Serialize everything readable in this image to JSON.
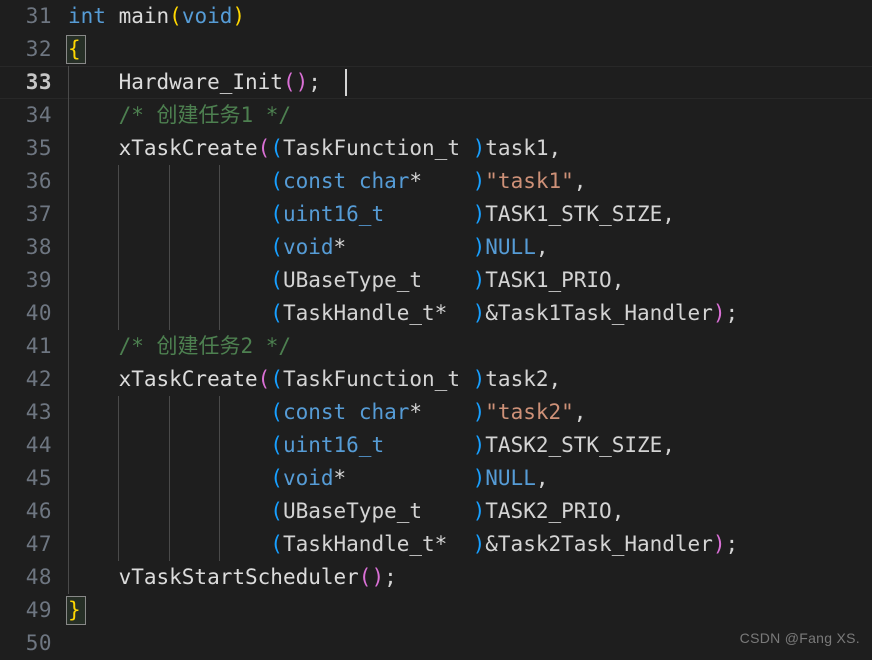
{
  "editor": {
    "language": "c",
    "theme": "dark-plus",
    "background_color": "#1e1e1e",
    "line_number_color": "#6e7681",
    "active_line_number_color": "#c6c6c6",
    "indent_guide_color": "#4a4a4a",
    "first_visible_line": 31,
    "last_visible_line": 50,
    "active_line": 33,
    "cursor_line": 33,
    "cursor_column": 23,
    "matching_brackets": [
      32,
      49
    ]
  },
  "colors": {
    "keyword": "#569cd6",
    "comment": "#4d8050",
    "string": "#ce9178",
    "identifier": "#d4d4d4",
    "bracket_yellow": "#ffd700",
    "bracket_magenta": "#da70d6",
    "bracket_blue": "#179fff"
  },
  "watermark": {
    "text": "CSDN @Fang XS."
  },
  "lines": [
    {
      "number": "31",
      "text": "int main(void)"
    },
    {
      "number": "32",
      "text": "{"
    },
    {
      "number": "33",
      "text": "    Hardware_Init();"
    },
    {
      "number": "34",
      "text": "    /* 创建任务1 */"
    },
    {
      "number": "35",
      "text": "    xTaskCreate((TaskFunction_t )task1,"
    },
    {
      "number": "36",
      "text": "                (const char*    )\"task1\","
    },
    {
      "number": "37",
      "text": "                (uint16_t       )TASK1_STK_SIZE,"
    },
    {
      "number": "38",
      "text": "                (void*          )NULL,"
    },
    {
      "number": "39",
      "text": "                (UBaseType_t    )TASK1_PRIO,"
    },
    {
      "number": "40",
      "text": "                (TaskHandle_t*  )&Task1Task_Handler);"
    },
    {
      "number": "41",
      "text": "    /* 创建任务2 */"
    },
    {
      "number": "42",
      "text": "    xTaskCreate((TaskFunction_t )task2,"
    },
    {
      "number": "43",
      "text": "                (const char*    )\"task2\","
    },
    {
      "number": "44",
      "text": "                (uint16_t       )TASK2_STK_SIZE,"
    },
    {
      "number": "45",
      "text": "                (void*          )NULL,"
    },
    {
      "number": "46",
      "text": "                (UBaseType_t    )TASK2_PRIO,"
    },
    {
      "number": "47",
      "text": "                (TaskHandle_t*  )&Task2Task_Handler);"
    },
    {
      "number": "48",
      "text": "    vTaskStartScheduler();"
    },
    {
      "number": "49",
      "text": "}"
    },
    {
      "number": "50",
      "text": ""
    }
  ],
  "tokens": {
    "l31": [
      {
        "t": "int",
        "c": "kw"
      },
      {
        "t": " ",
        "c": "punc"
      },
      {
        "t": "main",
        "c": "fn"
      },
      {
        "t": "(",
        "c": "p-yel"
      },
      {
        "t": "void",
        "c": "kw"
      },
      {
        "t": ")",
        "c": "p-yel"
      }
    ],
    "l32": [
      {
        "t": "{",
        "c": "p-yel"
      }
    ],
    "l33": [
      {
        "t": "    ",
        "c": "punc"
      },
      {
        "t": "Hardware_Init",
        "c": "fn"
      },
      {
        "t": "(",
        "c": "p-mag"
      },
      {
        "t": ")",
        "c": "p-mag"
      },
      {
        "t": ";",
        "c": "punc"
      }
    ],
    "l34": [
      {
        "t": "    ",
        "c": "punc"
      },
      {
        "t": "/* 创建任务1 */",
        "c": "cmt"
      }
    ],
    "l35": [
      {
        "t": "    ",
        "c": "punc"
      },
      {
        "t": "xTaskCreate",
        "c": "fn"
      },
      {
        "t": "(",
        "c": "p-mag"
      },
      {
        "t": "(",
        "c": "p-blu"
      },
      {
        "t": "TaskFunction_t ",
        "c": "id"
      },
      {
        "t": ")",
        "c": "p-blu"
      },
      {
        "t": "task1,",
        "c": "id"
      }
    ],
    "l36": [
      {
        "t": "                ",
        "c": "punc"
      },
      {
        "t": "(",
        "c": "p-blu"
      },
      {
        "t": "const",
        "c": "kw"
      },
      {
        "t": " ",
        "c": "punc"
      },
      {
        "t": "char",
        "c": "kw"
      },
      {
        "t": "*    ",
        "c": "id"
      },
      {
        "t": ")",
        "c": "p-blu"
      },
      {
        "t": "\"task1\"",
        "c": "str"
      },
      {
        "t": ",",
        "c": "punc"
      }
    ],
    "l37": [
      {
        "t": "                ",
        "c": "punc"
      },
      {
        "t": "(",
        "c": "p-blu"
      },
      {
        "t": "uint16_t",
        "c": "kw"
      },
      {
        "t": "       ",
        "c": "punc"
      },
      {
        "t": ")",
        "c": "p-blu"
      },
      {
        "t": "TASK1_STK_SIZE,",
        "c": "id"
      }
    ],
    "l38": [
      {
        "t": "                ",
        "c": "punc"
      },
      {
        "t": "(",
        "c": "p-blu"
      },
      {
        "t": "void",
        "c": "kw"
      },
      {
        "t": "*          ",
        "c": "id"
      },
      {
        "t": ")",
        "c": "p-blu"
      },
      {
        "t": "NULL",
        "c": "kw"
      },
      {
        "t": ",",
        "c": "punc"
      }
    ],
    "l39": [
      {
        "t": "                ",
        "c": "punc"
      },
      {
        "t": "(",
        "c": "p-blu"
      },
      {
        "t": "UBaseType_t    ",
        "c": "id"
      },
      {
        "t": ")",
        "c": "p-blu"
      },
      {
        "t": "TASK1_PRIO,",
        "c": "id"
      }
    ],
    "l40": [
      {
        "t": "                ",
        "c": "punc"
      },
      {
        "t": "(",
        "c": "p-blu"
      },
      {
        "t": "TaskHandle_t*  ",
        "c": "id"
      },
      {
        "t": ")",
        "c": "p-blu"
      },
      {
        "t": "&Task1Task_Handler",
        "c": "id"
      },
      {
        "t": ")",
        "c": "p-mag"
      },
      {
        "t": ";",
        "c": "punc"
      }
    ],
    "l41": [
      {
        "t": "    ",
        "c": "punc"
      },
      {
        "t": "/* 创建任务2 */",
        "c": "cmt"
      }
    ],
    "l42": [
      {
        "t": "    ",
        "c": "punc"
      },
      {
        "t": "xTaskCreate",
        "c": "fn"
      },
      {
        "t": "(",
        "c": "p-mag"
      },
      {
        "t": "(",
        "c": "p-blu"
      },
      {
        "t": "TaskFunction_t ",
        "c": "id"
      },
      {
        "t": ")",
        "c": "p-blu"
      },
      {
        "t": "task2,",
        "c": "id"
      }
    ],
    "l43": [
      {
        "t": "                ",
        "c": "punc"
      },
      {
        "t": "(",
        "c": "p-blu"
      },
      {
        "t": "const",
        "c": "kw"
      },
      {
        "t": " ",
        "c": "punc"
      },
      {
        "t": "char",
        "c": "kw"
      },
      {
        "t": "*    ",
        "c": "id"
      },
      {
        "t": ")",
        "c": "p-blu"
      },
      {
        "t": "\"task2\"",
        "c": "str"
      },
      {
        "t": ",",
        "c": "punc"
      }
    ],
    "l44": [
      {
        "t": "                ",
        "c": "punc"
      },
      {
        "t": "(",
        "c": "p-blu"
      },
      {
        "t": "uint16_t",
        "c": "kw"
      },
      {
        "t": "       ",
        "c": "punc"
      },
      {
        "t": ")",
        "c": "p-blu"
      },
      {
        "t": "TASK2_STK_SIZE,",
        "c": "id"
      }
    ],
    "l45": [
      {
        "t": "                ",
        "c": "punc"
      },
      {
        "t": "(",
        "c": "p-blu"
      },
      {
        "t": "void",
        "c": "kw"
      },
      {
        "t": "*          ",
        "c": "id"
      },
      {
        "t": ")",
        "c": "p-blu"
      },
      {
        "t": "NULL",
        "c": "kw"
      },
      {
        "t": ",",
        "c": "punc"
      }
    ],
    "l46": [
      {
        "t": "                ",
        "c": "punc"
      },
      {
        "t": "(",
        "c": "p-blu"
      },
      {
        "t": "UBaseType_t    ",
        "c": "id"
      },
      {
        "t": ")",
        "c": "p-blu"
      },
      {
        "t": "TASK2_PRIO,",
        "c": "id"
      }
    ],
    "l47": [
      {
        "t": "                ",
        "c": "punc"
      },
      {
        "t": "(",
        "c": "p-blu"
      },
      {
        "t": "TaskHandle_t*  ",
        "c": "id"
      },
      {
        "t": ")",
        "c": "p-blu"
      },
      {
        "t": "&Task2Task_Handler",
        "c": "id"
      },
      {
        "t": ")",
        "c": "p-mag"
      },
      {
        "t": ";",
        "c": "punc"
      }
    ],
    "l48": [
      {
        "t": "    ",
        "c": "punc"
      },
      {
        "t": "vTaskStartScheduler",
        "c": "fn"
      },
      {
        "t": "(",
        "c": "p-mag"
      },
      {
        "t": ")",
        "c": "p-mag"
      },
      {
        "t": ";",
        "c": "punc"
      }
    ],
    "l49": [
      {
        "t": "}",
        "c": "p-yel"
      }
    ],
    "l50": []
  },
  "indent_guides": {
    "l33": [
      1
    ],
    "l34": [
      1
    ],
    "l35": [
      1
    ],
    "l36": [
      1,
      2,
      3,
      4
    ],
    "l37": [
      1,
      2,
      3,
      4
    ],
    "l38": [
      1,
      2,
      3,
      4
    ],
    "l39": [
      1,
      2,
      3,
      4
    ],
    "l40": [
      1,
      2,
      3,
      4
    ],
    "l41": [
      1
    ],
    "l42": [
      1
    ],
    "l43": [
      1,
      2,
      3,
      4
    ],
    "l44": [
      1,
      2,
      3,
      4
    ],
    "l45": [
      1,
      2,
      3,
      4
    ],
    "l46": [
      1,
      2,
      3,
      4
    ],
    "l47": [
      1,
      2,
      3,
      4
    ],
    "l48": [
      1
    ]
  }
}
